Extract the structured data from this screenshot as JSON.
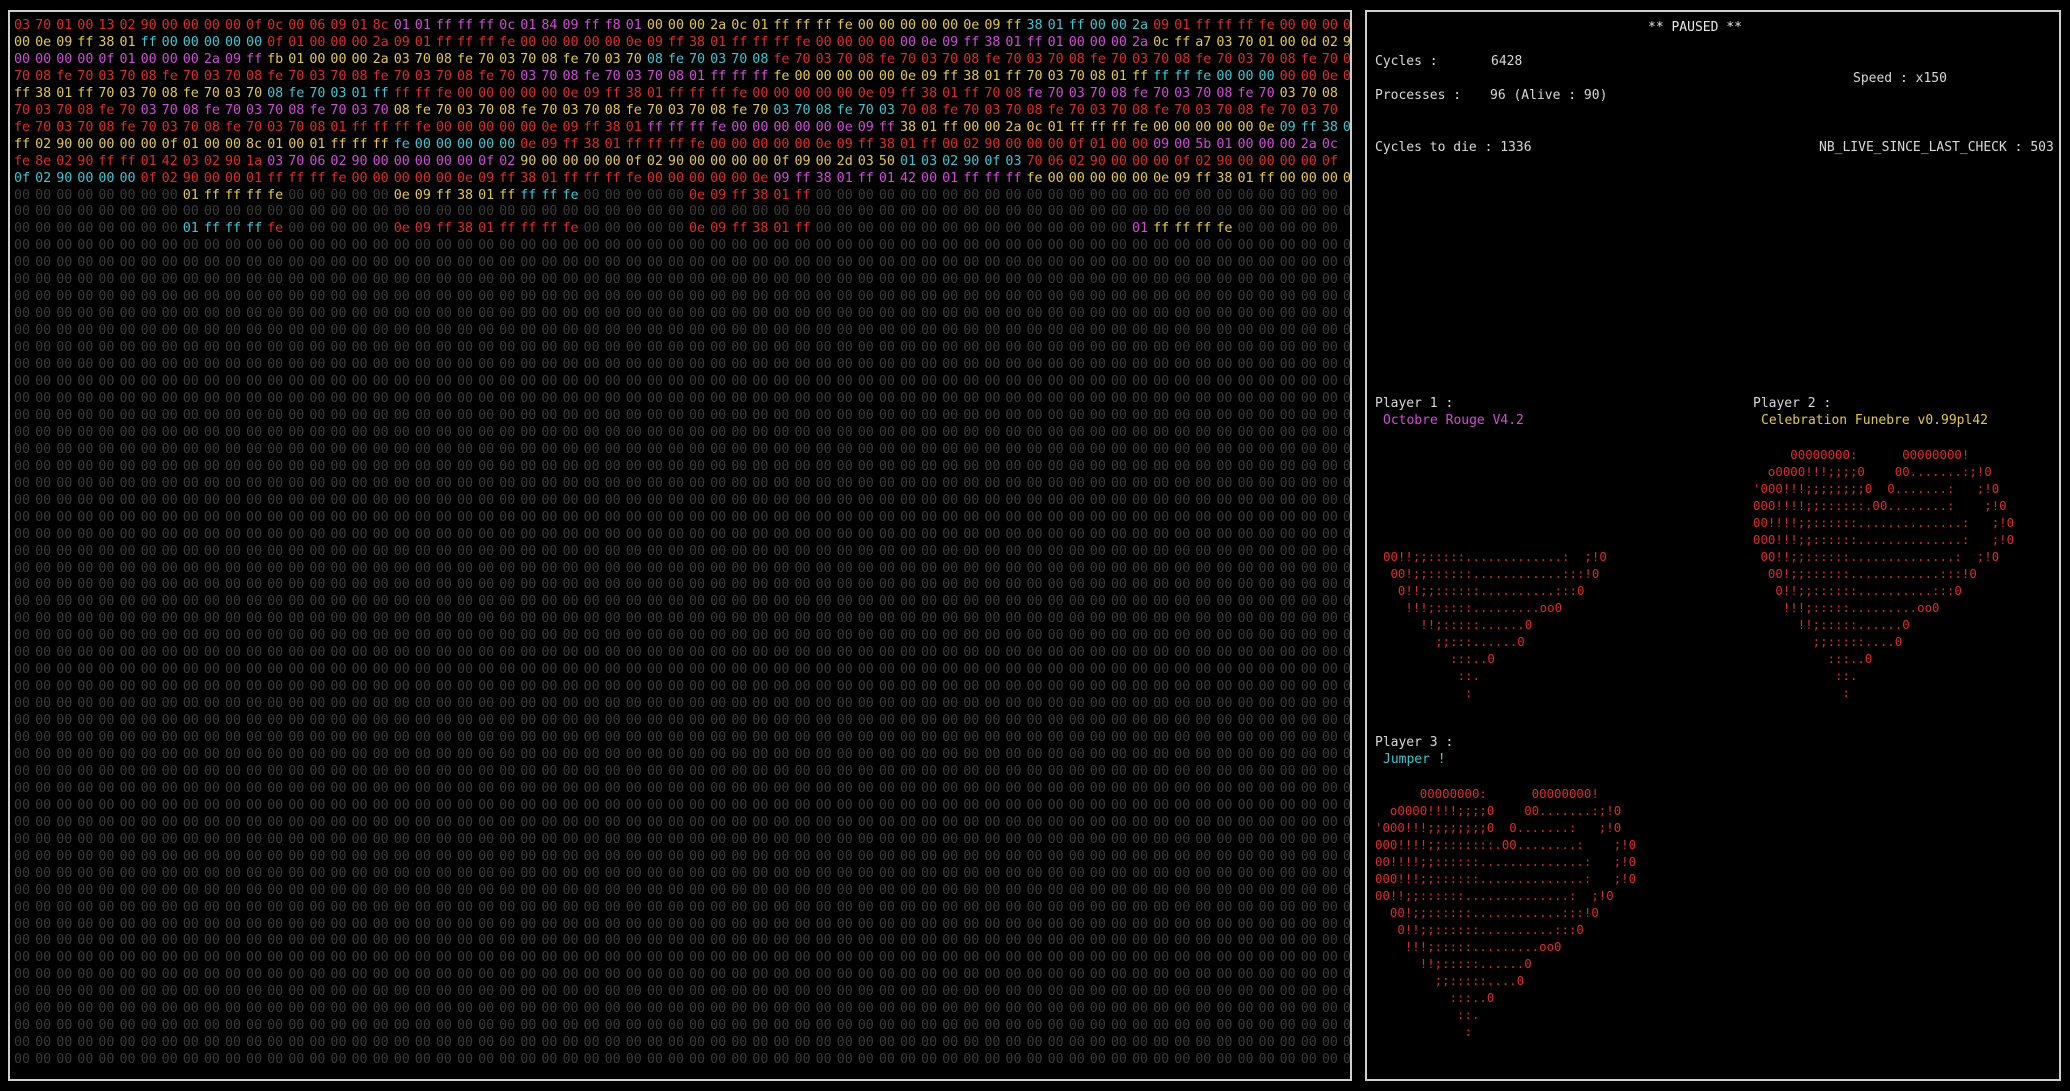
{
  "colors": {
    "background": "#000000",
    "empty_cell": "#3a3a3a",
    "player1": "#d24ad8",
    "player2": "#e3c940",
    "player3": "#38c8d2",
    "player4": "#e02a2a",
    "panel_text": "#d8d8d8",
    "border": "#cfcfcf"
  },
  "status": "** PAUSED **",
  "cycles_label": "Cycles :",
  "cycles_value": "6428",
  "processes_label": "Processes :",
  "processes_value": "96 (Alive : 90)",
  "speed_label": "Speed : x150",
  "cycles_to_die_label": "Cycles to die : 1336",
  "nbr_live_label": "NB_LIVE_SINCE_LAST_CHECK : 503",
  "players": [
    {
      "label": "Player 1 :",
      "name": "Octobre Rouge V4.2",
      "color": "#d24ad8"
    },
    {
      "label": "Player 2 :",
      "name": "Celebration Funebre v0.99pl42",
      "color": "#e3c940"
    },
    {
      "label": "Player 3 :",
      "name": "Jumper !",
      "color": "#38c8d2"
    }
  ],
  "heart_art": [
    "00!!;;:::::.............:  ;!0\n 00!;;::::::............:::!0\n  0!!;;::::::..........:::0\n   !!!;:::::.........oo0\n     !!;:::::......0\n       ;;:::......0\n         :::..0\n          ::.\n           :",
    "     00000000:      00000000!\n  o0000!!!;;;;0    00.......:;!0\n'000!!!;;;;;;;;0  0.......:   ;!0\n000!!!!;;::::::.00........:    ;!0\n00!!!!;;::::::..............:   ;!0\n000!!!;;::::::..............:   ;!0\n 00!!;;::::::..............:  ;!0\n  00!;;::::::............:::!0\n   0!!;;::::::..........:::0\n    !!!;:::::.........oo0\n      !!;:::::......0\n        ;;:::::....0\n          :::..0\n           ::.\n            :",
    "      00000000:      00000000!\n  o0000!!!!;;;;0    00.......:;!0\n'000!!!;;;;;;;;0  0.......:   ;!0\n000!!!!;;:::::::.00........:    ;!0\n00!!!!;;::::::..............:   ;!0\n000!!!;;::::::..............:   ;!0\n00!!;;::::::..............:  ;!0\n  00!;;::::::............:::!0\n   0!!;;::::::..........:::0\n    !!!;:::::.........oo0\n      !!;:::::......0\n        ;;:::::....0\n          :::..0\n           ::.\n            :"
  ],
  "memory_rows": [
    "03 70 01 00 13 02 90 00 00 00 00 0f 0c 00 06 09 01 8c 01 01 ff ff ff 0c 01 84 09 ff f8 01 00 00 00 2a 0c 01 ff ff ff fe 00 00 00 00 00 0e 09 ff 38 01 ff 00 00 2a 09 01 ff ff ff fe 00 00 00 00",
    "00 0e 09 ff 38 01 ff 00 00 00 00 00 0f 01 00 00 00 2a 09 01 ff ff ff fe 00 00 00 00 00 0e 09 ff 38 01 ff ff ff fe 00 00 00 00 00 0e 09 ff 38 01 ff 01 00 00 00 2a 0c ff a7 03 70 01 00 0d 02 90",
    "00 00 00 00 0f 01 00 00 00 2a 09 ff fb 01 00 00 00 2a 03 70 08 fe 70 03 70 08 fe 70 03 70 08 fe 70 03 70 08 fe 70 03 70 08 fe 70 03 70 08 fe 70 03 70 08 fe 70 03 70 08 fe 70 03 70 08 fe 70 03",
    "70 08 fe 70 03 70 08 fe 70 03 70 08 fe 70 03 70 08 fe 70 03 70 08 fe 70 03 70 08 fe 70 03 70 08 01 ff ff ff fe 00 00 00 00 00 0e 09 ff 38 01 ff 70 03 70 08 01 ff ff ff fe 00 00 00 00 00 0e 09",
    "ff 38 01 ff 70 03 70 08 fe 70 03 70 08 fe 70 03 01 ff ff ff fe 00 00 00 00 00 0e 09 ff 38 01 ff ff ff fe 00 00 00 00 00 0e 09 ff 38 01 ff 70 08 fe 70 03 70 08 fe 70 03 70 08 fe 70 03 70 08",
    "70 03 70 08 fe 70 03 70 08 fe 70 03 70 08 fe 70 03 70 08 fe 70 03 70 08 fe 70 03 70 08 fe 70 03 70 08 fe 70 03 70 08 fe 70 03 70 08 fe 70 03 70 08 fe 70 03 70 08 fe 70 03 70 08 fe 70 03 70",
    "fe 70 03 70 08 fe 70 03 70 08 fe 70 03 70 08 01 ff ff ff fe 00 00 00 00 00 0e 09 ff 38 01 ff ff ff fe 00 00 00 00 00 0e 09 ff 38 01 ff 00 00 2a 0c 01 ff ff ff fe 00 00 00 00 00 0e 09 ff 38 01",
    "ff 02 90 00 00 00 00 0f 01 00 00 8c 01 00 01 ff ff ff fe 00 00 00 00 00 0e 09 ff 38 01 ff ff ff fe 00 00 00 00 00 0e 09 ff 38 01 ff 00 02 90 00 00 00 0f 01 00 00 09 00 5b 01 00 00 00 2a 0c",
    "fe 8e 02 90 ff ff 01 42 03 02 90 1a 03 70 06 02 90 00 00 00 00 00 0f 02 90 00 00 00 00 0f 02 90 00 00 00 00 0f 09 00 2d 03 50 01 03 02 90 0f 03 70 06 02 90 00 00 00 0f 02 90 00 00 00 00 0f",
    "0f 02 90 00 00 00 0f 02 90 00 00 01 ff ff ff fe 00 00 00 00 00 0e 09 ff 38 01 ff ff ff fe 00 00 00 00 00 0e 09 ff 38 01 ff 01 42 00 01 ff ff ff fe 00 00 00 00 00 0e 09 ff 38 01 ff 00 00 00 00",
    "00 00 00 00 00 00 00 00 01 ff ff ff fe 00 00 00 00 00 0e 09 ff 38 01 ff ff ff fe 00 00 00 00 00 0e 09 ff 38 01 ff 00 00 00 00 00 00 00 00 00 00 00 00 00 00 00 00 00 00 00 00 00 00 00 00 00",
    "00 00 00 00 00 00 00 00 00 00 00 00 00 00 00 00 00 00 00 00 00 00 00 00 00 00 00 00 00 00 00 00 00 00 00 00 00 00 00 00 00 00 00 00 00 00 00 00 00 00 00 00 00 00 00 00 00 00 00 00 00 00 00 00",
    "00 00 00 00 00 00 00 00 01 ff ff ff fe 00 00 00 00 00 0e 09 ff 38 01 ff ff ff fe 00 00 00 00 00 0e 09 ff 38 01 ff 00 00 00 00 00 00 00 00 00 00 00 00 00 00 00 01 ff ff ff fe 00 00 00 00 00",
    "00 00 00 00 00 00 00 00 00 00 00 00 00 00 00 00 00 00 00 00 00 00 00 00 00 00 00 00 00 00 00 00 00 00 00 00 00 00 00 00 00 00 00 00 00 00 00 00 00 00 00 00 00 00 00 00 00 00 00 00 00 00 00 00",
    "00 00 00 00 00 00 00 00 00 00 00 00 00 00 00 00 00 00 00 00 00 00 00 00 00 00 00 00 00 00 00 00 00 00 00 00 00 00 00 00 00 00 00 00 00 00 00 00 00 00 00 00 00 00 00 00 00 00 00 00 00 00 00 00"
  ]
}
